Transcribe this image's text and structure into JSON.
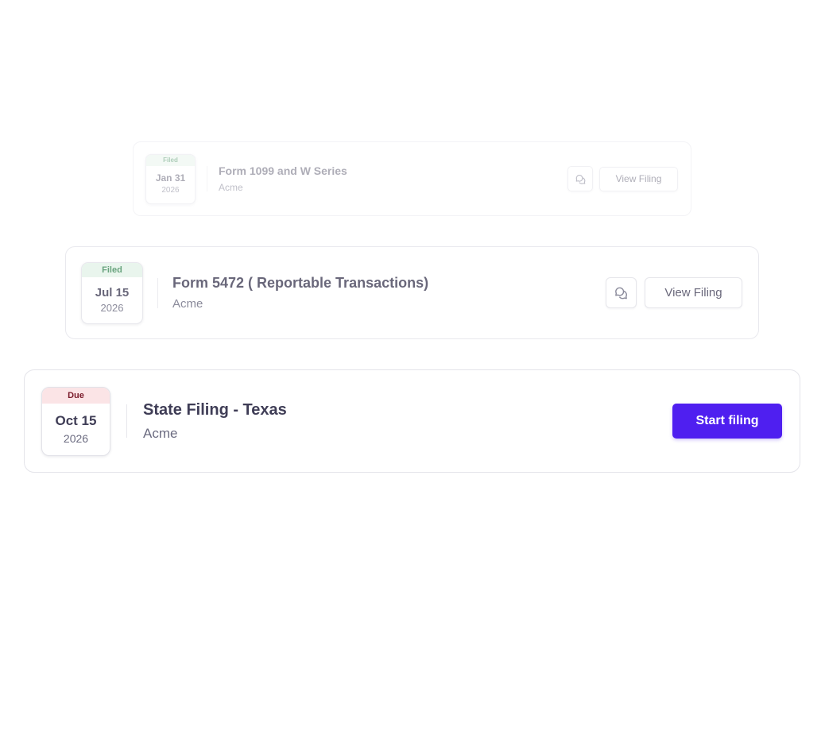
{
  "filings": [
    {
      "status": "Filed",
      "date": "Jan 31",
      "year": "2026",
      "title": "Form 1099 and W Series",
      "company": "Acme",
      "comment_icon": "chat-bubbles-icon",
      "action_label": "View Filing"
    },
    {
      "status": "Filed",
      "date": "Jul 15",
      "year": "2026",
      "title": "Form 5472 ( Reportable Transactions)",
      "company": "Acme",
      "comment_icon": "chat-bubbles-icon",
      "action_label": "View Filing"
    },
    {
      "status": "Due",
      "date": "Oct 15",
      "year": "2026",
      "title": "State Filing - Texas",
      "company": "Acme",
      "action_label": "Start filing"
    }
  ],
  "colors": {
    "filed_bg": "#e3f3e8",
    "filed_text": "#3f8a5a",
    "due_bg": "#fbe4e6",
    "due_text": "#7a1a2a",
    "primary": "#4f1ff0"
  }
}
